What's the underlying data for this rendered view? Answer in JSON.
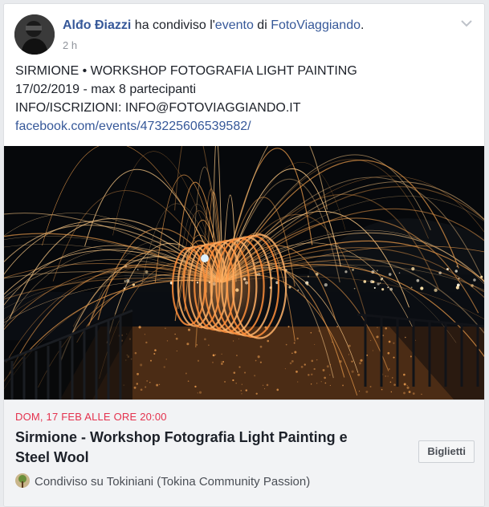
{
  "post": {
    "author": "Alđo Điazzi",
    "shared_text": "ha condiviso l'",
    "event_word": "evento",
    "of_text": " di ",
    "page_name": "FotoViaggiando",
    "period": ".",
    "time": "2 h",
    "body_lines": [
      "SIRMIONE • WORKSHOP FOTOGRAFIA LIGHT PAINTING",
      "17/02/2019 - max 8 partecipanti",
      "INFO/ISCRIZIONI: INFO@FOTOVIAGGIANDO.IT"
    ],
    "link": "facebook.com/events/473225606539582/"
  },
  "event": {
    "date": "DOM, 17 FEB ALLE ORE 20:00",
    "title": "Sirmione - Workshop Fotografia Light Painting e Steel Wool",
    "tickets_label": "Biglietti",
    "shared_in": "Condiviso su Tokiniani (Tokina Community Passion)"
  },
  "colors": {
    "link": "#365899",
    "date": "#e4314d",
    "background": "#e9ebee"
  },
  "icons": [
    "avatar-photo",
    "chevron-down-icon",
    "group-icon"
  ]
}
